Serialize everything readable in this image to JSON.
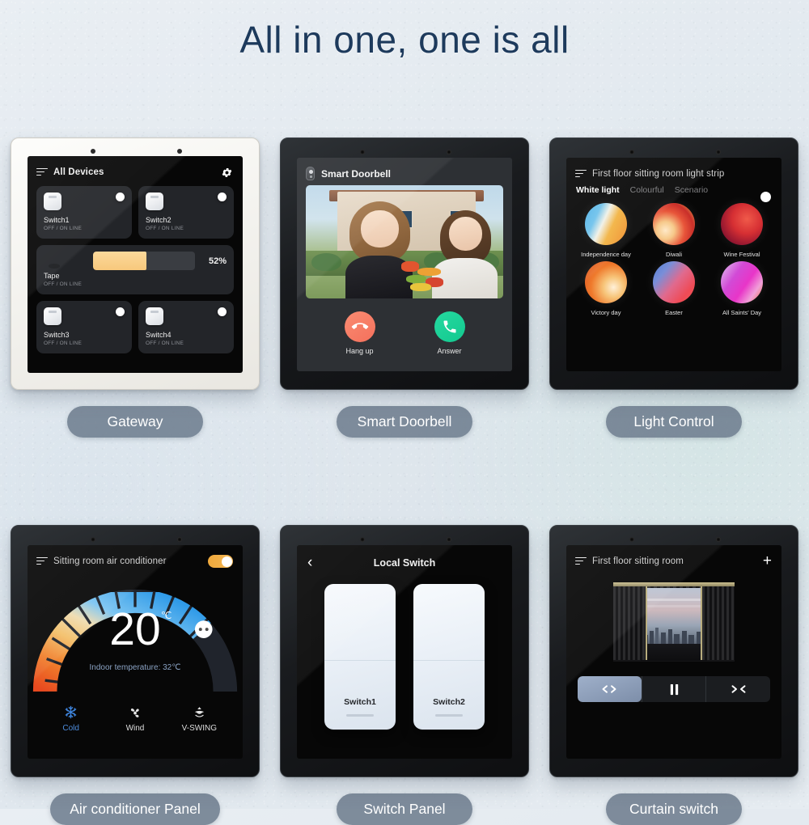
{
  "page": {
    "title": "All in one, one is all"
  },
  "panels": [
    {
      "caption": "Gateway",
      "header": {
        "title": "All Devices",
        "menu_icon": "menu-icon",
        "action_icon": "gear-icon"
      },
      "devices": [
        {
          "name": "Switch1",
          "status": "OFF / ON LINE",
          "icon": "switch-icon"
        },
        {
          "name": "Switch2",
          "status": "OFF / ON LINE",
          "icon": "switch-icon"
        },
        {
          "name": "Switch3",
          "status": "OFF / ON LINE",
          "icon": "switch-icon"
        },
        {
          "name": "Switch4",
          "status": "OFF / ON LINE",
          "icon": "switch-icon"
        }
      ],
      "dimmer": {
        "name": "Tape",
        "status": "OFF / ON LINE",
        "value": "52%",
        "percent": 52,
        "icon": "light-ring-icon"
      }
    },
    {
      "caption": "Smart Doorbell",
      "header": {
        "title": "Smart Doorbell",
        "icon": "doorbell-icon"
      },
      "actions": [
        {
          "label": "Hang up",
          "icon": "phone-hangup-icon",
          "color": "#f4705c"
        },
        {
          "label": "Answer",
          "icon": "phone-answer-icon",
          "color": "#13c98f"
        }
      ]
    },
    {
      "caption": "Light Control",
      "header": {
        "title": "First floor sitting room light strip",
        "menu_icon": "menu-icon"
      },
      "toggle_on": true,
      "tabs": [
        {
          "label": "White light",
          "active": true
        },
        {
          "label": "Colourful",
          "active": false
        },
        {
          "label": "Scenario",
          "active": false
        }
      ],
      "scenes": [
        {
          "label": "Independence day"
        },
        {
          "label": "Diwali"
        },
        {
          "label": "Wine Festival"
        },
        {
          "label": "Victory day"
        },
        {
          "label": "Easter"
        },
        {
          "label": "All Saints' Day"
        }
      ]
    },
    {
      "caption": "Air conditioner Panel",
      "header": {
        "title": "Sitting room air conditioner",
        "menu_icon": "menu-icon"
      },
      "toggle_on": true,
      "set_temperature": "20",
      "unit": "℃",
      "indoor_text": "Indoor temperature: 32℃",
      "modes": [
        {
          "label": "Cold",
          "icon": "snowflake-icon",
          "active": true
        },
        {
          "label": "Wind",
          "icon": "fan-icon",
          "active": false
        },
        {
          "label": "V-SWING",
          "icon": "swing-icon",
          "active": false
        }
      ]
    },
    {
      "caption": "Switch Panel",
      "header": {
        "title": "Local Switch",
        "back_icon": "chevron-left-icon"
      },
      "switches": [
        {
          "label": "Switch1"
        },
        {
          "label": "Switch2"
        }
      ]
    },
    {
      "caption": "Curtain switch",
      "header": {
        "title": "First floor sitting room",
        "menu_icon": "menu-icon",
        "action_icon": "plus-icon"
      },
      "controls": [
        {
          "name": "open",
          "icon": "curtain-open-icon",
          "active": true
        },
        {
          "name": "pause",
          "icon": "pause-icon",
          "active": false
        },
        {
          "name": "close",
          "icon": "curtain-close-icon",
          "active": false
        }
      ]
    }
  ]
}
